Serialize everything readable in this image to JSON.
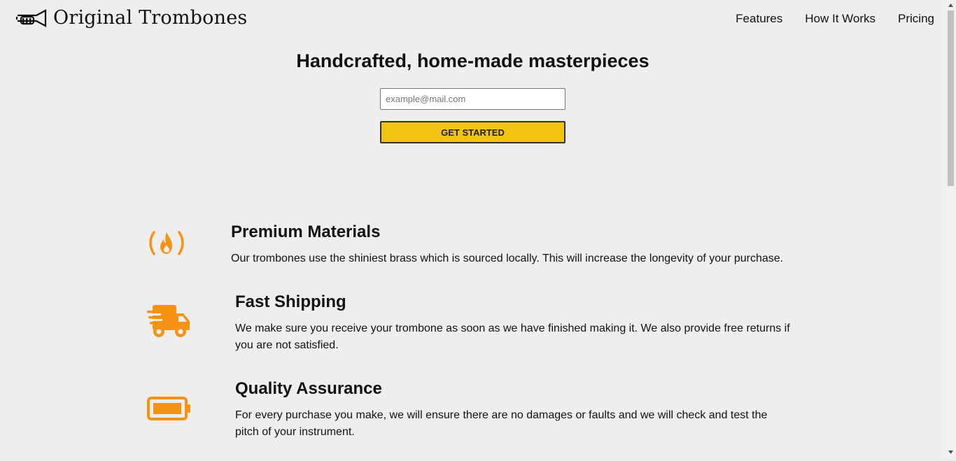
{
  "header": {
    "logo_text": "Original Trombones",
    "nav": [
      {
        "label": "Features"
      },
      {
        "label": "How It Works"
      },
      {
        "label": "Pricing"
      }
    ]
  },
  "hero": {
    "title": "Handcrafted, home-made masterpieces",
    "email_placeholder": "example@mail.com",
    "cta_label": "GET STARTED"
  },
  "features": [
    {
      "icon": "fire-icon",
      "title": "Premium Materials",
      "description": "Our trombones use the shiniest brass which is sourced locally. This will increase the longevity of your purchase."
    },
    {
      "icon": "truck-icon",
      "title": "Fast Shipping",
      "description": "We make sure you receive your trombone as soon as we have finished making it. We also provide free returns if you are not satisfied."
    },
    {
      "icon": "battery-icon",
      "title": "Quality Assurance",
      "description": "For every purchase you make, we will ensure there are no damages or faults and we will check and test the pitch of your instrument."
    }
  ],
  "colors": {
    "background": "#eeeeee",
    "accent": "#f1c40f",
    "icon": "#f89212"
  }
}
